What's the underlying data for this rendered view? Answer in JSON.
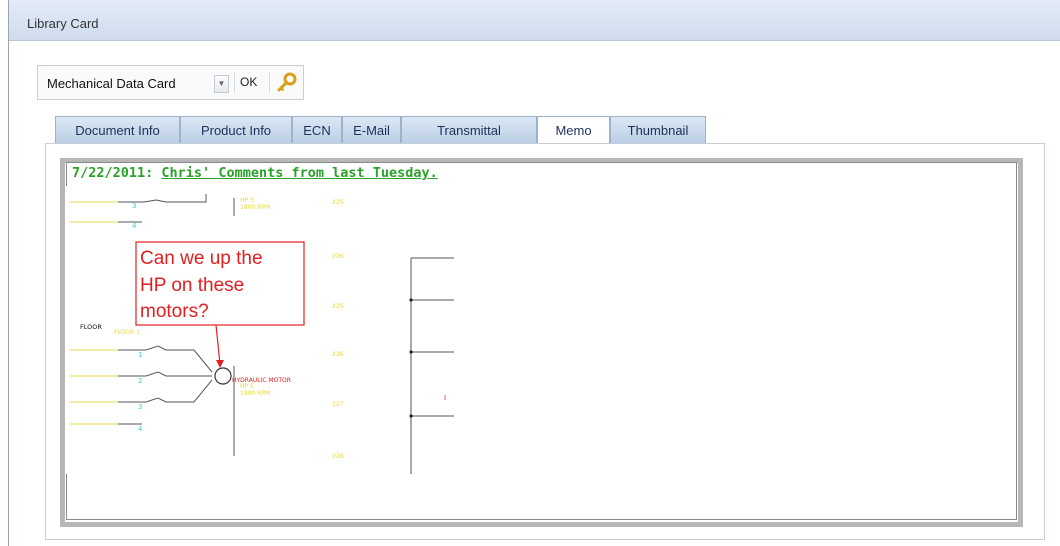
{
  "window": {
    "title": "Library Card"
  },
  "toolbar": {
    "card_type": "Mechanical Data Card",
    "ok_label": "OK",
    "key_icon": "key-icon"
  },
  "tabs": [
    {
      "label": "Document Info",
      "active": false
    },
    {
      "label": "Product Info",
      "active": false
    },
    {
      "label": "ECN",
      "active": false
    },
    {
      "label": "E-Mail",
      "active": false
    },
    {
      "label": "Transmittal",
      "active": false
    },
    {
      "label": "Memo",
      "active": true
    },
    {
      "label": "Thumbnail",
      "active": false
    }
  ],
  "memo": {
    "date": "7/22/2011:",
    "comment": "Chris' Comments from last Tuesday.",
    "callout": "Can we up the HP on these motors?",
    "callout_lines": [
      "Can we up the",
      "HP on these",
      "motors?"
    ],
    "schematic": {
      "floor_label": "FLOOR",
      "motor_label": "HYDRAULIC MOTOR",
      "line_numbers": [
        "225",
        "226",
        "227"
      ],
      "terminal_numbers": [
        "3",
        "4",
        "1",
        "2",
        "3",
        "4"
      ]
    }
  },
  "colors": {
    "accent_green": "#2aa12a",
    "callout_red": "#e32020",
    "schematic_yellow": "#e8d84a"
  }
}
